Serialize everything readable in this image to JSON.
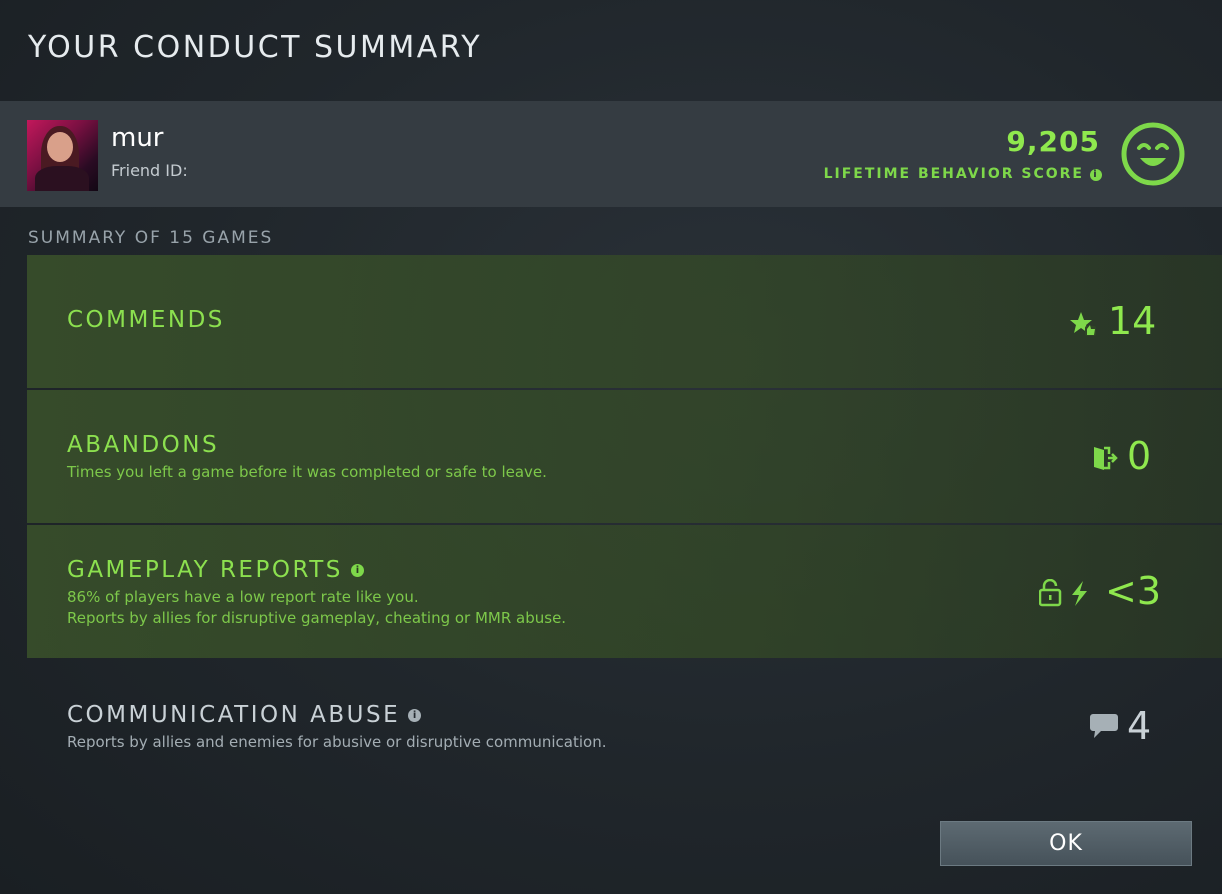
{
  "dialog": {
    "title": "YOUR CONDUCT SUMMARY"
  },
  "profile": {
    "username": "mur",
    "friend_id_label": "Friend ID:",
    "behavior_score": "9,205",
    "behavior_score_label": "LIFETIME BEHAVIOR SCORE"
  },
  "summary": {
    "label": "SUMMARY OF 15 GAMES",
    "rows": [
      {
        "title": "COMMENDS",
        "description": "",
        "value": "14",
        "icon": "star-thumbs-up-icon"
      },
      {
        "title": "ABANDONS",
        "description": "Times you left a game before it was completed or safe to leave.",
        "value": "0",
        "icon": "exit-door-icon"
      },
      {
        "title": "GAMEPLAY REPORTS",
        "description_lines": [
          "86% of players have a low report rate like you.",
          "Reports by allies for disruptive gameplay, cheating or MMR abuse."
        ],
        "value": "<3",
        "icon": "unlock-lightning-icon"
      },
      {
        "title": "COMMUNICATION ABUSE",
        "description": "Reports by allies and enemies for abusive or disruptive communication.",
        "value": "4",
        "icon": "chat-bubble-icon"
      }
    ]
  },
  "ok_button": {
    "label": "OK"
  },
  "colors": {
    "accent_green": "#8fe84e",
    "panel": "#353c42",
    "background": "#22282d"
  }
}
